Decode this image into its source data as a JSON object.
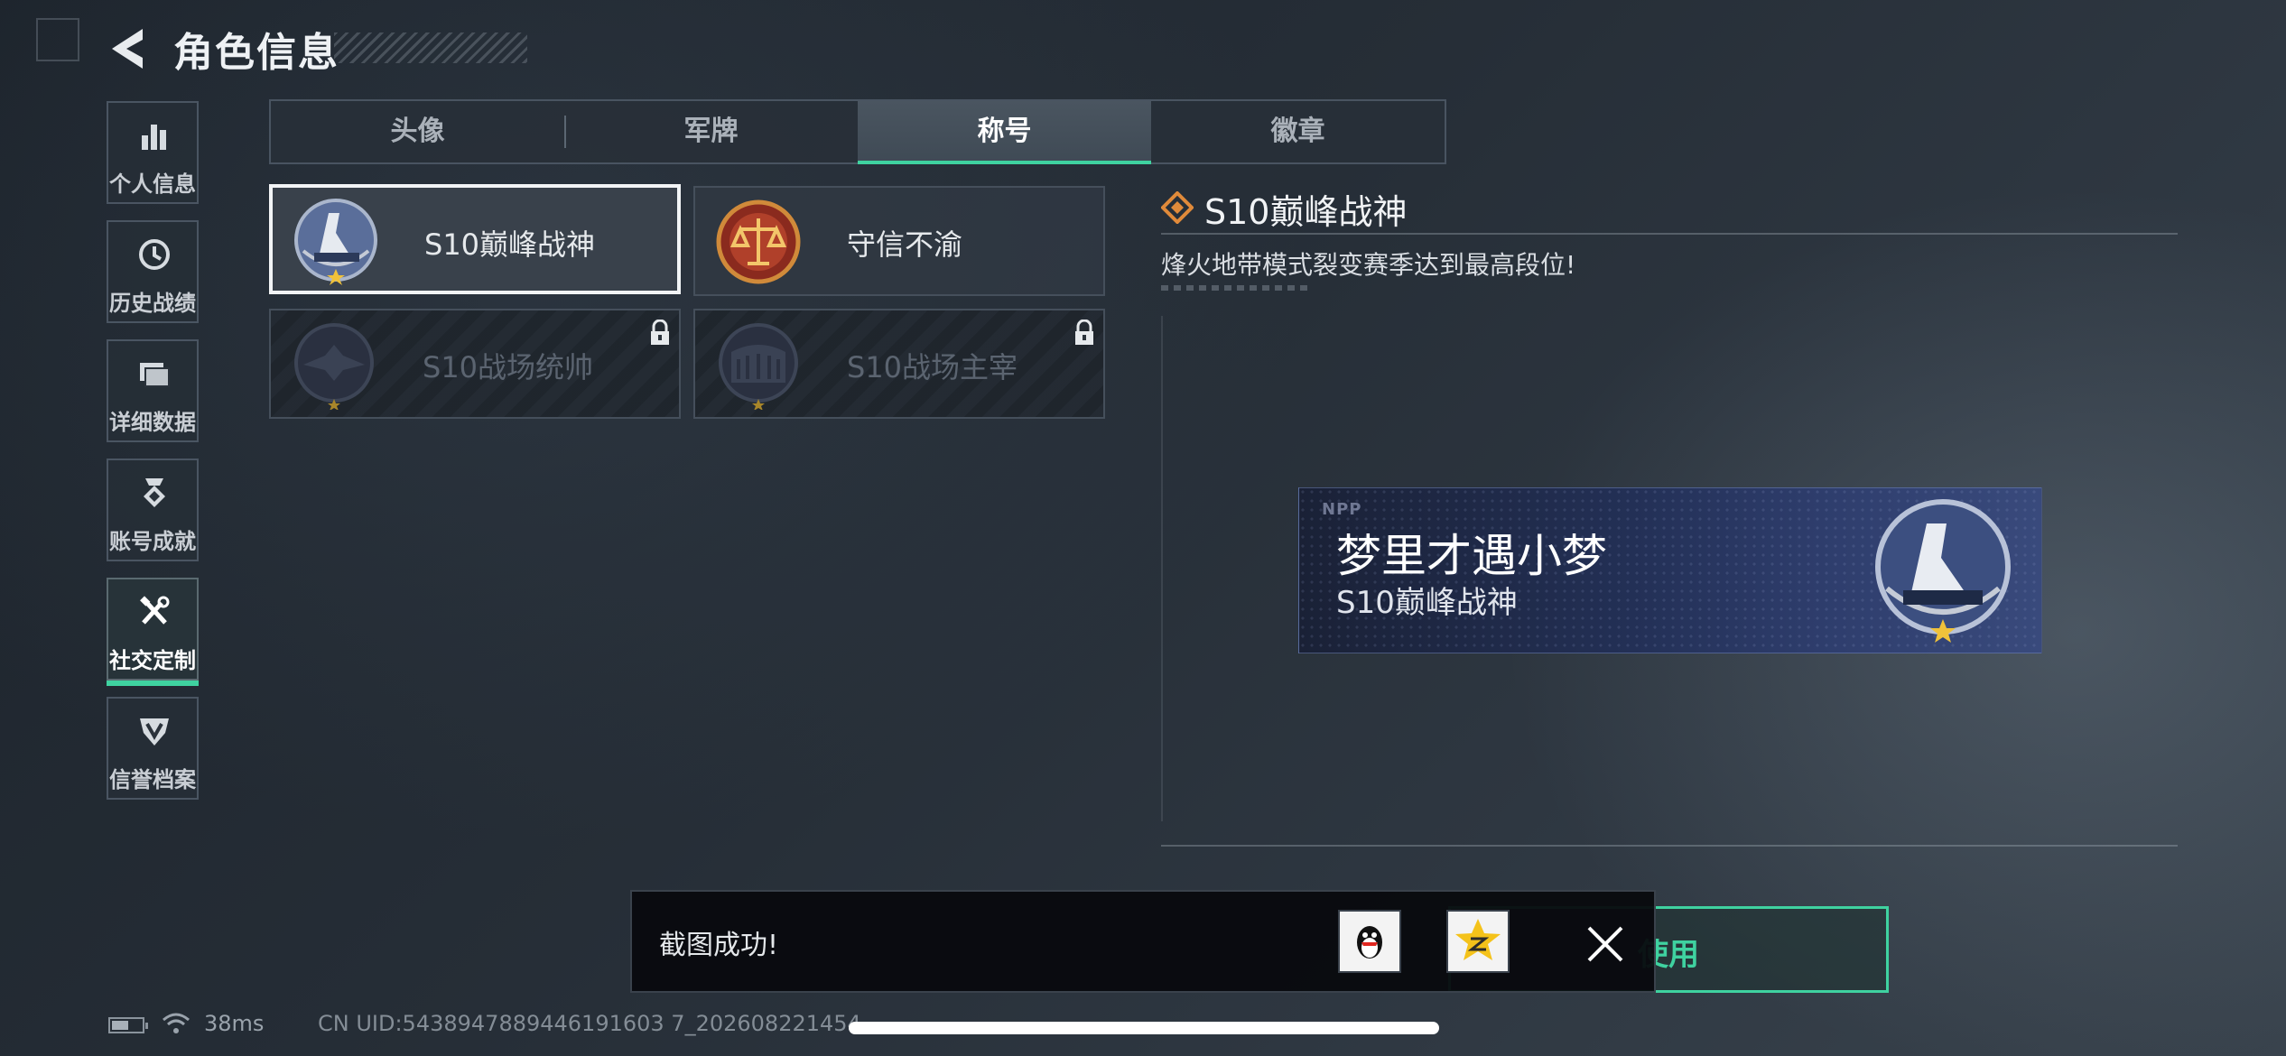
{
  "header": {
    "title": "角色信息"
  },
  "sidebar": {
    "items": [
      {
        "label": "个人信息",
        "icon": "bar-chart-icon",
        "active": false
      },
      {
        "label": "历史战绩",
        "icon": "clock-icon",
        "active": false
      },
      {
        "label": "详细数据",
        "icon": "folder-icon",
        "active": false
      },
      {
        "label": "账号成就",
        "icon": "medal-icon",
        "active": false
      },
      {
        "label": "社交定制",
        "icon": "tools-icon",
        "active": true
      },
      {
        "label": "信誉档案",
        "icon": "shield-icon",
        "active": false
      }
    ]
  },
  "tabs": [
    {
      "label": "头像",
      "active": false
    },
    {
      "label": "军牌",
      "active": false
    },
    {
      "label": "称号",
      "active": true
    },
    {
      "label": "徽章",
      "active": false
    }
  ],
  "titles": [
    {
      "name": "S10巅峰战神",
      "selected": true,
      "locked": false,
      "emblem": "peak-war-god-emblem-icon"
    },
    {
      "name": "守信不渝",
      "selected": false,
      "locked": false,
      "emblem": "scales-emblem-icon"
    },
    {
      "name": "S10战场统帅",
      "selected": false,
      "locked": true,
      "emblem": "commander-emblem-icon"
    },
    {
      "name": "S10战场主宰",
      "selected": false,
      "locked": true,
      "emblem": "colosseum-emblem-icon"
    }
  ],
  "detail": {
    "title": "S10巅峰战神",
    "description": "烽火地带模式裂变赛季达到最高段位!"
  },
  "preview": {
    "tag": "NPP",
    "player_name": "梦里才遇小梦",
    "title": "S10巅峰战神"
  },
  "toast": {
    "message": "截图成功!",
    "share_icons": [
      "qq-icon",
      "qzone-icon"
    ]
  },
  "use_button": {
    "label": "使用"
  },
  "status": {
    "ping": "38ms",
    "uid": "CN UID:5438947889446191603 7_202608221454"
  },
  "colors": {
    "accent": "#3fd2a0",
    "plate": "#2e3d6c",
    "orange": "#e08a3a"
  }
}
